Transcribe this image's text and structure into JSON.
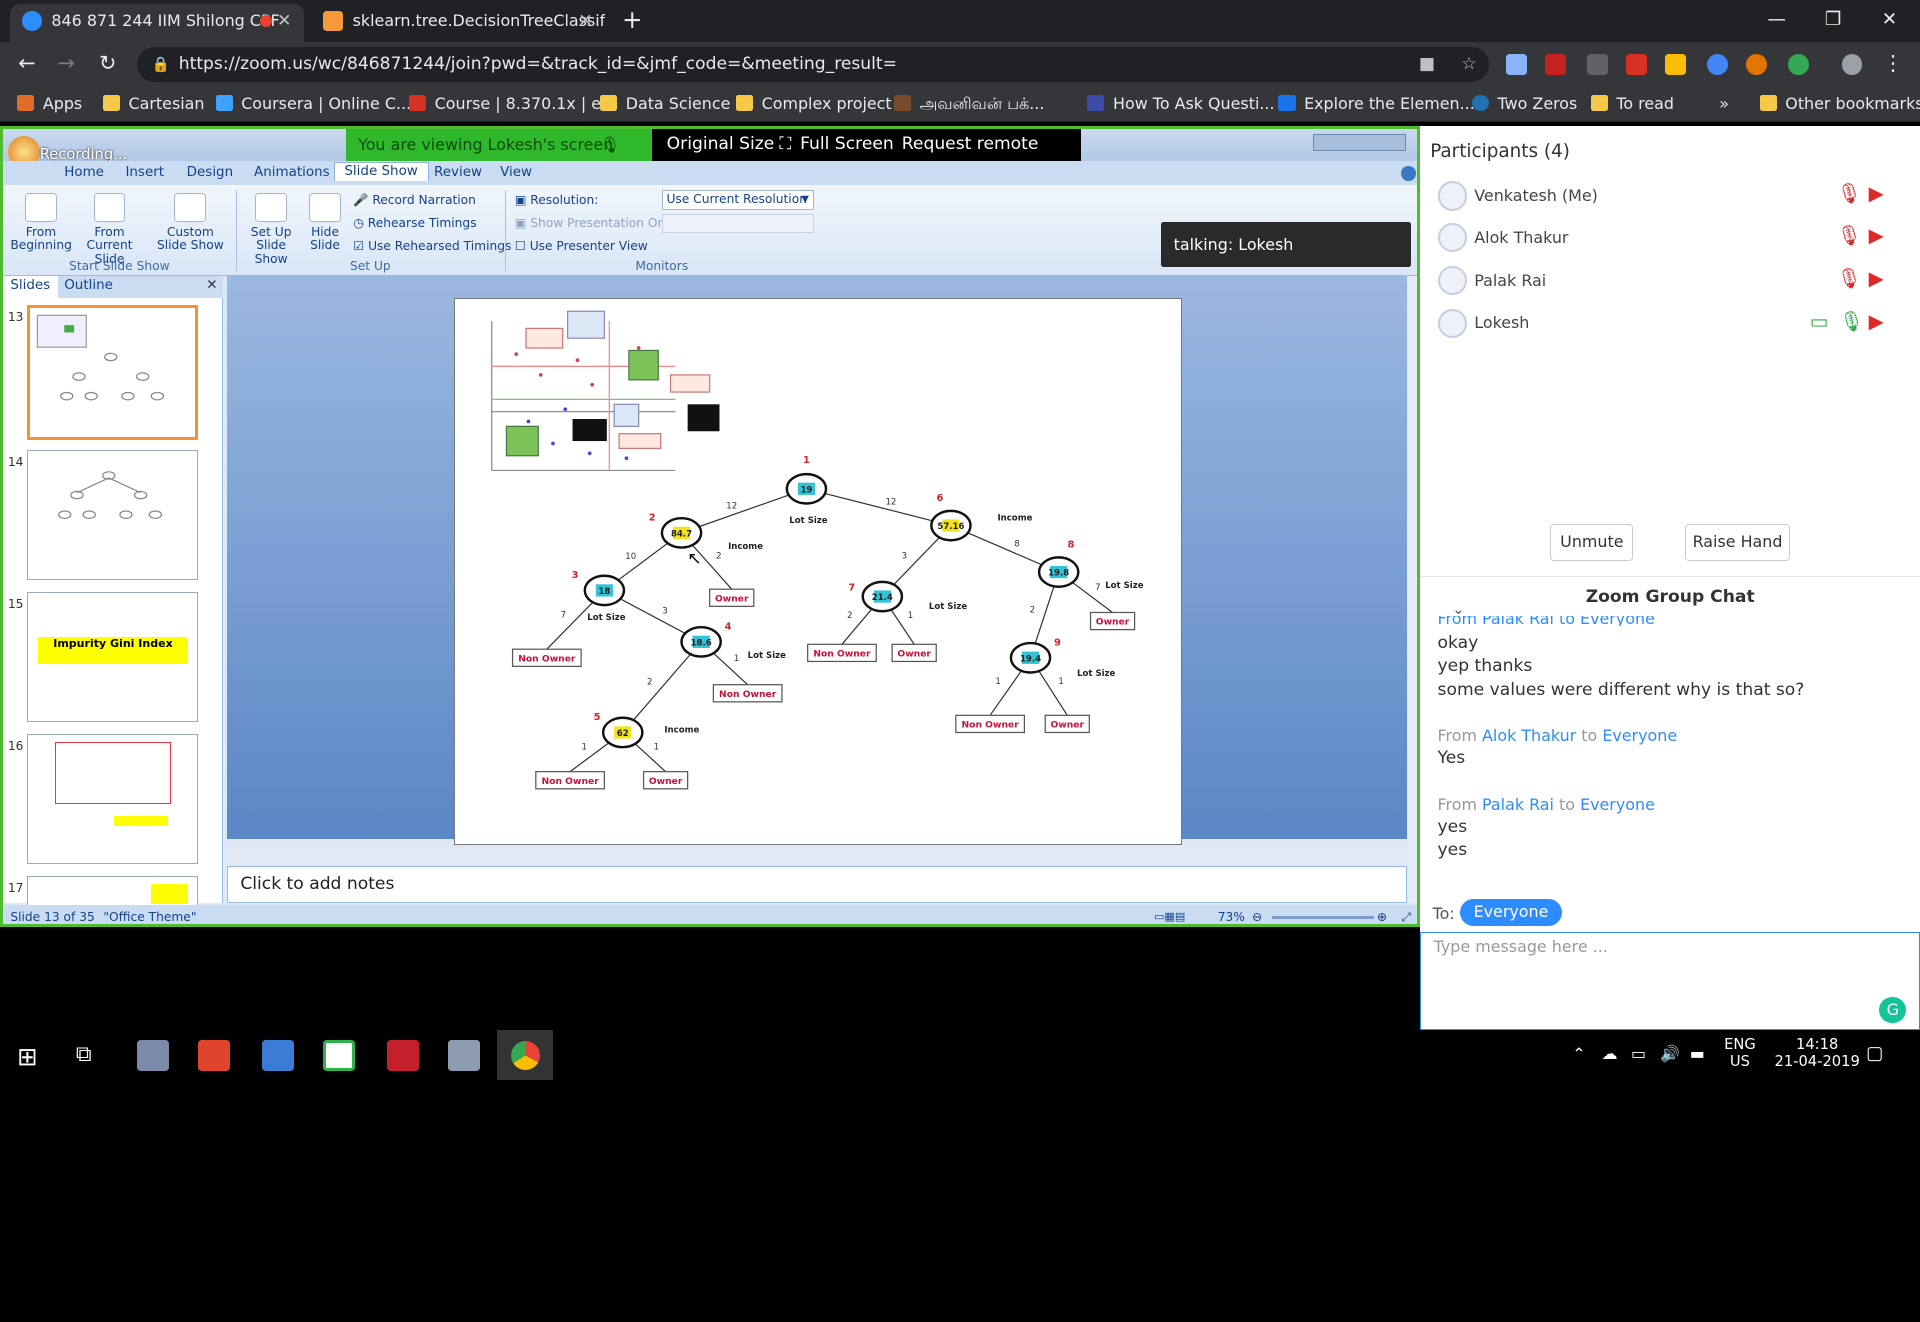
{
  "browser": {
    "tabs": [
      {
        "title": "846 871 244 IIM Shilong CPF"
      },
      {
        "title": "sklearn.tree.DecisionTreeClassifie"
      }
    ],
    "url": "https://zoom.us/wc/846871244/join?pwd=&track_id=&jmf_code=&meeting_result=",
    "bookmarks": [
      "Apps",
      "Cartesian",
      "Coursera | Online C...",
      "Course | 8.370.1x | e...",
      "Data Science",
      "Complex project",
      "அவனிவன் பக்...",
      "How To Ask Questi...",
      "Explore the Elemen...",
      "Two Zeros",
      "To read",
      "»",
      "Other bookmarks"
    ]
  },
  "share": {
    "viewing": "You are viewing Lokesh's screen",
    "original_size": "Original Size",
    "full_screen": "Full Screen",
    "remote": "Request remote control",
    "recording": "Recording...",
    "talking": "talking: Lokesh"
  },
  "ppt": {
    "ribbon_tabs": [
      "Home",
      "Insert",
      "Design",
      "Animations",
      "Slide Show",
      "Review",
      "View"
    ],
    "from_beginning": "From Beginning",
    "from_current": "From Current Slide",
    "custom_show": "Custom Slide Show",
    "setup": "Set Up Slide Show",
    "hide": "Hide Slide",
    "record": "Record Narration",
    "rehearse": "Rehearse Timings",
    "use_rehearsed": "Use Rehearsed Timings",
    "resolution": "Resolution:",
    "resolution_value": "Use Current Resolution",
    "show_on": "Show Presentation On:",
    "presenter": "Use Presenter View",
    "group_start": "Start Slide Show",
    "group_setup": "Set Up",
    "group_monitors": "Monitors",
    "pane_slides": "Slides",
    "pane_outline": "Outline",
    "thumb_numbers": [
      "13",
      "14",
      "15",
      "16",
      "17"
    ],
    "thumb15_text": "Impurity Gini Index",
    "notes": "Click to add notes",
    "status_slide": "Slide 13 of 35",
    "status_theme": "\"Office Theme\"",
    "zoom": "73%"
  },
  "tree": {
    "nodes": [
      {
        "num": "1",
        "value": "19",
        "label": "Lot Size"
      },
      {
        "num": "2",
        "value": "84.7",
        "label": "Income"
      },
      {
        "num": "6",
        "value": "57.16",
        "label": "Income"
      },
      {
        "num": "3",
        "value": "18",
        "label": "Lot Size"
      },
      {
        "num": "4",
        "value": "18.6",
        "label": "Lot Size"
      },
      {
        "num": "5",
        "value": "62",
        "label": "Income"
      },
      {
        "num": "7",
        "value": "21.4",
        "label": "Lot Size"
      },
      {
        "num": "8",
        "value": "19.8",
        "label": "Lot Size"
      },
      {
        "num": "9",
        "value": "19.4",
        "label": "Lot Size"
      }
    ],
    "non_owner": "Non Owner",
    "owner": "Owner",
    "edge_labels": [
      "12",
      "12",
      "10",
      "2",
      "7",
      "3",
      "1",
      "2",
      "1",
      "1",
      "3",
      "8",
      "2",
      "1",
      "7",
      "2",
      "1",
      "1"
    ]
  },
  "panel": {
    "participants_title": "Participants (4)",
    "participants": [
      "Venkatesh (Me)",
      "Alok Thakur",
      "Palak Rai",
      "Lokesh"
    ],
    "unmute": "Unmute",
    "raise_hand": "Raise Hand",
    "chat_title": "Zoom Group Chat",
    "chat_partial": "From Palak Rai to Everyone",
    "messages": [
      "okay",
      "yep thanks",
      "some values were different why is that so?"
    ],
    "from1": "From",
    "from1_name": "Alok Thakur",
    "to_word": "to",
    "everyone": "Everyone",
    "msg2": "Yes",
    "from2_name": "Palak Rai",
    "msg3a": "yes",
    "msg3b": "yes",
    "to_label": "To:",
    "to_value": "Everyone",
    "input_placeholder": "Type message here ..."
  },
  "taskbar": {
    "lang1": "ENG",
    "lang2": "US",
    "time": "14:18",
    "date": "21-04-2019"
  },
  "colors": {
    "zoom_blue": "#2d8cff",
    "share_border": "#4fbb2f",
    "node_red": "#d42020"
  }
}
